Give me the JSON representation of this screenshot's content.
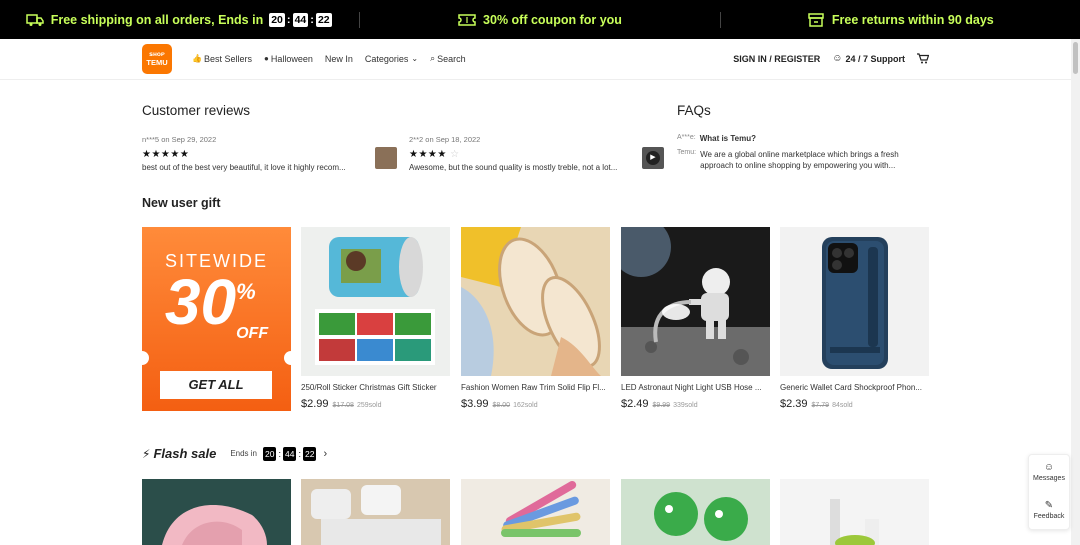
{
  "promo": {
    "shipping": "Free shipping on all orders, Ends in",
    "timer": [
      "20",
      "44",
      "22"
    ],
    "coupon": "30% off coupon for you",
    "returns": "Free returns within 90 days"
  },
  "header": {
    "logo_top": "ꜱʜᴏᴩ",
    "logo_bottom": "TEMU",
    "nav": [
      "Best Sellers",
      "Halloween",
      "New In",
      "Categories",
      "Search"
    ],
    "signin": "SIGN IN / REGISTER",
    "support": "24 / 7 Support"
  },
  "reviews": {
    "title": "Customer reviews",
    "items": [
      {
        "user": "n***5",
        "date": "on Sep 29, 2022",
        "stars": "★★★★★",
        "empty": "",
        "text": "best out of the best very beautiful, it love it highly recom..."
      },
      {
        "user": "2**2",
        "date": "on Sep 18, 2022",
        "stars": "★★★★",
        "empty": "☆",
        "text": "Awesome, but the sound quality is mostly treble, not a lot..."
      }
    ]
  },
  "faqs": {
    "title": "FAQs",
    "items": [
      {
        "who": "A***e:",
        "text": "What is Temu?"
      },
      {
        "who": "Temu:",
        "text": "We are a global online marketplace which brings a fresh approach to online shopping by empowering you with..."
      }
    ]
  },
  "new_user": {
    "title": "New user gift",
    "gift": {
      "line1": "SITEWIDE",
      "num": "30",
      "pct": "%",
      "off": "OFF",
      "button": "GET ALL"
    },
    "products": [
      {
        "name": "250/Roll Sticker Christmas Gift Sticker",
        "price": "$2.99",
        "old": "$17.08",
        "sold": "259sold"
      },
      {
        "name": "Fashion Women Raw Trim Solid Flip Fl...",
        "price": "$3.99",
        "old": "$8.00",
        "sold": "162sold"
      },
      {
        "name": "LED Astronaut Night Light USB Hose ...",
        "price": "$2.49",
        "old": "$9.99",
        "sold": "339sold"
      },
      {
        "name": "Generic Wallet Card Shockproof Phon...",
        "price": "$2.39",
        "old": "$7.79",
        "sold": "84sold"
      }
    ]
  },
  "flash": {
    "title": "Flash sale",
    "ends": "Ends in",
    "timer": [
      "20",
      "44",
      "22"
    ]
  },
  "side": {
    "messages": "Messages",
    "feedback": "Feedback"
  }
}
